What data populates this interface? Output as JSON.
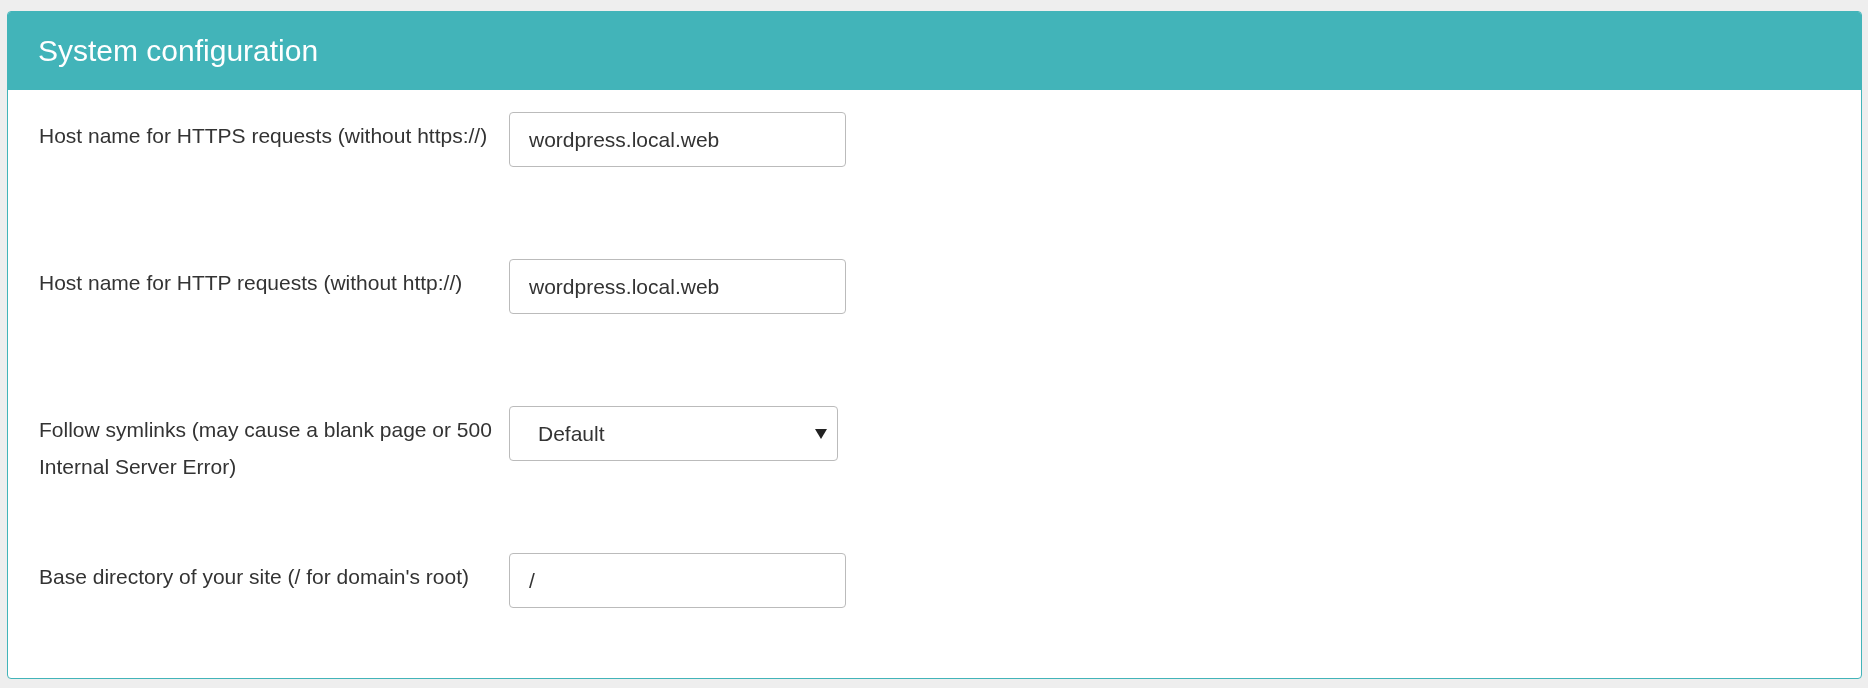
{
  "panel": {
    "title": "System configuration"
  },
  "fields": [
    {
      "kind": "text",
      "label": "Host name for HTTPS requests (without https://)",
      "value": "wordpress.local.web"
    },
    {
      "kind": "text",
      "label": "Host name for HTTP requests (without http://)",
      "value": "wordpress.local.web"
    },
    {
      "kind": "select",
      "label": "Follow symlinks (may cause a blank page or 500 Internal Server Error)",
      "value": "Default"
    },
    {
      "kind": "text",
      "label": "Base directory of your site (/ for domain's root)",
      "value": "/"
    }
  ]
}
